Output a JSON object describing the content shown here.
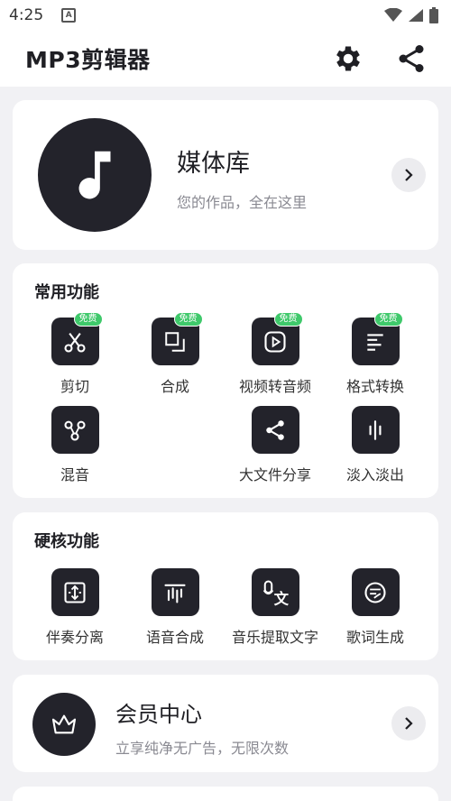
{
  "status": {
    "time": "4:25"
  },
  "appbar": {
    "title": "MP3剪辑器",
    "settings_icon": "gear-icon",
    "share_icon": "share-icon"
  },
  "media": {
    "title": "媒体库",
    "subtitle": "您的作品，全在这里"
  },
  "common": {
    "title": "常用功能",
    "tools": [
      {
        "label": "剪切",
        "badge": "免费",
        "icon": "scissors-icon"
      },
      {
        "label": "合成",
        "badge": "免费",
        "icon": "merge-icon"
      },
      {
        "label": "视频转音频",
        "badge": "免费",
        "icon": "video-play-icon"
      },
      {
        "label": "格式转换",
        "badge": "免费",
        "icon": "format-lines-icon"
      },
      {
        "label": "混音",
        "icon": "mix-nodes-icon"
      },
      {
        "label": "大文件分享",
        "icon": "share-icon"
      },
      {
        "label": "淡入淡出",
        "icon": "waveform-icon"
      }
    ]
  },
  "hard": {
    "title": "硬核功能",
    "tools": [
      {
        "label": "伴奏分离",
        "icon": "split-icon"
      },
      {
        "label": "语音合成",
        "icon": "voice-synth-icon"
      },
      {
        "label": "音乐提取文字",
        "icon": "music-to-text-icon"
      },
      {
        "label": "歌词生成",
        "icon": "lyrics-icon"
      }
    ]
  },
  "vip": {
    "title": "会员中心",
    "subtitle": "立享纯净无广告，无限次数"
  },
  "colors": {
    "dark": "#23232b",
    "badge": "#3fc96b",
    "background": "#f1f1f4"
  }
}
